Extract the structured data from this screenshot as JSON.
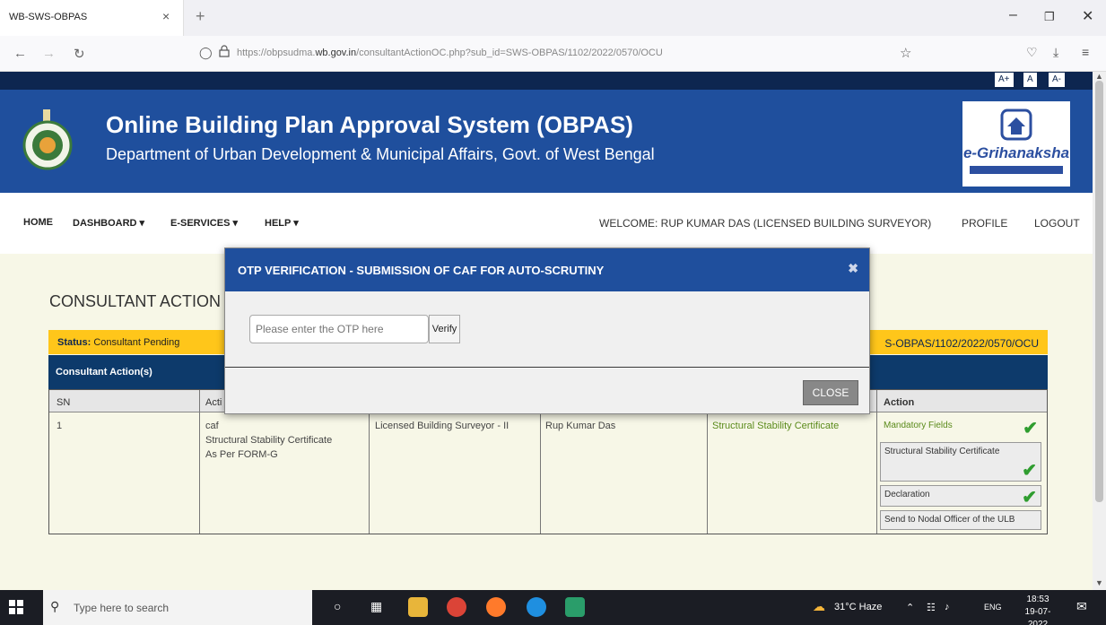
{
  "browser": {
    "tab_title": "WB-SWS-OBPAS",
    "tab_close": "×",
    "new_tab": "+",
    "url_prefix": "https://obpsudma.",
    "url_domain": "wb.gov.in",
    "url_path": "/consultantActionOC.php?sub_id=SWS-OBPAS/1102/2022/0570/OCU"
  },
  "font_controls": [
    "A+",
    "A",
    "A-"
  ],
  "header": {
    "title": "Online Building Plan Approval System (OBPAS)",
    "subtitle": "Department of Urban Development & Municipal Affairs, Govt. of West Bengal",
    "logo_text": "e-Grihanaksha"
  },
  "nav": {
    "home": "HOME",
    "dashboard": "DASHBOARD ▾",
    "eservices": "E-SERVICES ▾",
    "help": "HELP ▾",
    "welcome": "WELCOME: RUP KUMAR DAS (LICENSED BUILDING SURVEYOR)",
    "profile": "PROFILE",
    "logout": "LOGOUT"
  },
  "main": {
    "section_title": "CONSULTANT ACTION",
    "status_label": "Status:",
    "status_value": "Consultant Pending",
    "application_id": "S-OBPAS/1102/2022/0570/OCU",
    "actions_header": "Consultant Action(s)"
  },
  "table": {
    "headers": {
      "sn": "SN",
      "activity": "Acti",
      "action": "Action"
    },
    "row": {
      "sn": "1",
      "activity_1": "caf",
      "activity_2": "Structural Stability Certificate",
      "activity_3": "As Per FORM-G",
      "role": "Licensed Building Surveyor - II",
      "name": "Rup Kumar Das",
      "document": "Structural Stability Certificate"
    },
    "actions": {
      "mandatory": "Mandatory Fields",
      "stability": "Structural Stability Certificate",
      "declaration": "Declaration",
      "send": "Send to Nodal Officer of the ULB"
    }
  },
  "modal": {
    "title": "OTP VERIFICATION - SUBMISSION OF CAF FOR AUTO-SCRUTINY",
    "otp_placeholder": "Please enter the OTP here",
    "verify_label": "Verify",
    "close_label": "CLOSE"
  },
  "taskbar": {
    "search_placeholder": "Type here to search",
    "weather": "31°C  Haze",
    "language": "ENG",
    "time": "18:53",
    "date": "19-07-2022"
  },
  "colors": {
    "header_blue": "#1f4f9d",
    "dark_navy": "#0d2650",
    "status_yellow": "#ffc61a",
    "check_green": "#2f9d2f"
  }
}
